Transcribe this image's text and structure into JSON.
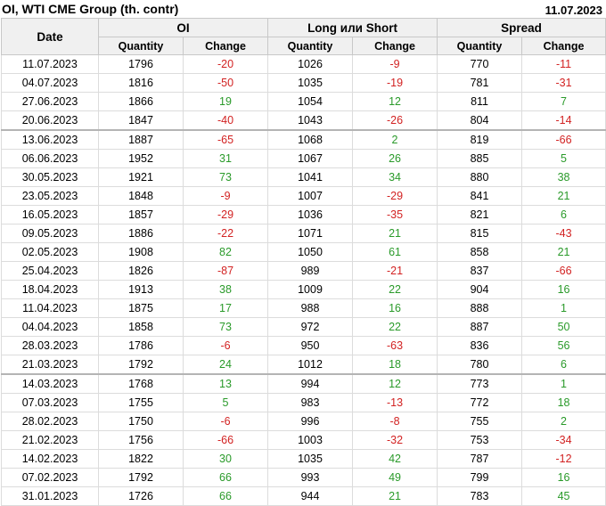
{
  "header": {
    "title": "OI, WTI CME Group (th. contr)",
    "date": "11.07.2023"
  },
  "columns": {
    "date": "Date",
    "groups": [
      "OI",
      "Long или Short",
      "Spread"
    ],
    "sub": [
      "Quantity",
      "Change",
      "Quantity",
      "Change",
      "Quantity",
      "Change"
    ]
  },
  "colors": {
    "positive": "#2a9a2a",
    "negative": "#d22222"
  },
  "rows": [
    [
      "11.07.2023",
      "1796",
      "-20",
      "1026",
      "-9",
      "770",
      "-11"
    ],
    [
      "04.07.2023",
      "1816",
      "-50",
      "1035",
      "-19",
      "781",
      "-31"
    ],
    [
      "27.06.2023",
      "1866",
      "19",
      "1054",
      "12",
      "811",
      "7"
    ],
    [
      "20.06.2023",
      "1847",
      "-40",
      "1043",
      "-26",
      "804",
      "-14"
    ],
    [
      "13.06.2023",
      "1887",
      "-65",
      "1068",
      "2",
      "819",
      "-66"
    ],
    [
      "06.06.2023",
      "1952",
      "31",
      "1067",
      "26",
      "885",
      "5"
    ],
    [
      "30.05.2023",
      "1921",
      "73",
      "1041",
      "34",
      "880",
      "38"
    ],
    [
      "23.05.2023",
      "1848",
      "-9",
      "1007",
      "-29",
      "841",
      "21"
    ],
    [
      "16.05.2023",
      "1857",
      "-29",
      "1036",
      "-35",
      "821",
      "6"
    ],
    [
      "09.05.2023",
      "1886",
      "-22",
      "1071",
      "21",
      "815",
      "-43"
    ],
    [
      "02.05.2023",
      "1908",
      "82",
      "1050",
      "61",
      "858",
      "21"
    ],
    [
      "25.04.2023",
      "1826",
      "-87",
      "989",
      "-21",
      "837",
      "-66"
    ],
    [
      "18.04.2023",
      "1913",
      "38",
      "1009",
      "22",
      "904",
      "16"
    ],
    [
      "11.04.2023",
      "1875",
      "17",
      "988",
      "16",
      "888",
      "1"
    ],
    [
      "04.04.2023",
      "1858",
      "73",
      "972",
      "22",
      "887",
      "50"
    ],
    [
      "28.03.2023",
      "1786",
      "-6",
      "950",
      "-63",
      "836",
      "56"
    ],
    [
      "21.03.2023",
      "1792",
      "24",
      "1012",
      "18",
      "780",
      "6"
    ],
    [
      "14.03.2023",
      "1768",
      "13",
      "994",
      "12",
      "773",
      "1"
    ],
    [
      "07.03.2023",
      "1755",
      "5",
      "983",
      "-13",
      "772",
      "18"
    ],
    [
      "28.02.2023",
      "1750",
      "-6",
      "996",
      "-8",
      "755",
      "2"
    ],
    [
      "21.02.2023",
      "1756",
      "-66",
      "1003",
      "-32",
      "753",
      "-34"
    ],
    [
      "14.02.2023",
      "1822",
      "30",
      "1035",
      "42",
      "787",
      "-12"
    ],
    [
      "07.02.2023",
      "1792",
      "66",
      "993",
      "49",
      "799",
      "16"
    ],
    [
      "31.01.2023",
      "1726",
      "66",
      "944",
      "21",
      "783",
      "45"
    ]
  ]
}
